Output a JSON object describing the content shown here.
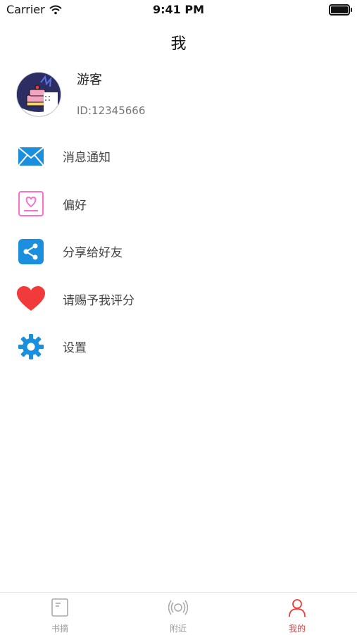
{
  "status_bar": {
    "carrier": "Carrier",
    "time": "9:41 PM"
  },
  "nav": {
    "title": "我"
  },
  "profile": {
    "name": "游客",
    "id": "ID:12345666"
  },
  "menu": [
    {
      "label": "消息通知",
      "icon": "envelope-icon",
      "color": "#1a8fdd"
    },
    {
      "label": "偏好",
      "icon": "heart-card-icon",
      "color": "#ff6fd0"
    },
    {
      "label": "分享给好友",
      "icon": "share-icon",
      "color": "#1a8fdd"
    },
    {
      "label": "请赐予我评分",
      "icon": "heart-icon",
      "color": "#f23a3a"
    },
    {
      "label": "设置",
      "icon": "gear-icon",
      "color": "#1a8fdd"
    }
  ],
  "tabs": [
    {
      "label": "书摘",
      "icon": "book-icon",
      "active": false
    },
    {
      "label": "附近",
      "icon": "radar-icon",
      "active": false
    },
    {
      "label": "我的",
      "icon": "person-icon",
      "active": true
    }
  ],
  "colors": {
    "active_tab": "#ef3b3b",
    "inactive_tab": "#999999"
  }
}
